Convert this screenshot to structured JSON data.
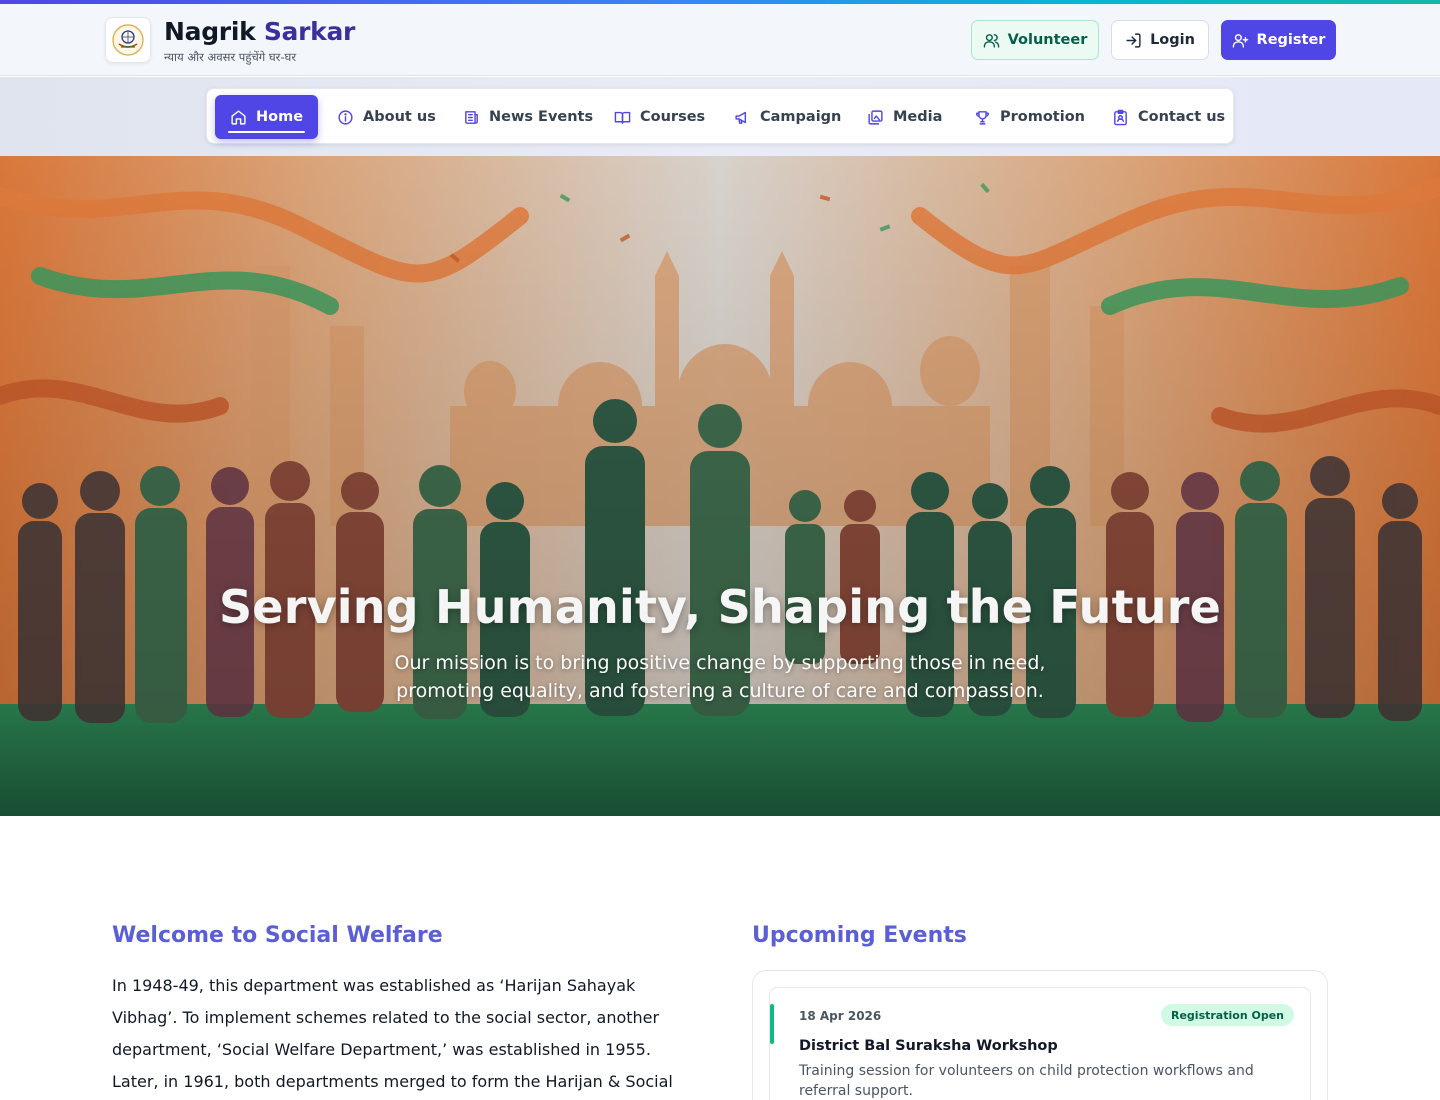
{
  "brand": {
    "name_part1": "Nagrik",
    "name_part2": "Sarkar",
    "tagline": "न्याय और अवसर पहुंचेंगे घर-घर",
    "logo_icon": "emblem-logo"
  },
  "header_actions": {
    "volunteer": "Volunteer",
    "login": "Login",
    "register": "Register"
  },
  "nav": {
    "items": [
      {
        "label": "Home",
        "icon": "home-icon",
        "active": true
      },
      {
        "label": "About us",
        "icon": "info-icon"
      },
      {
        "label": "News Events",
        "icon": "newspaper-icon"
      },
      {
        "label": "Courses",
        "icon": "book-icon"
      },
      {
        "label": "Campaign",
        "icon": "megaphone-icon"
      },
      {
        "label": "Media",
        "icon": "gallery-icon"
      },
      {
        "label": "Promotion",
        "icon": "trophy-icon"
      },
      {
        "label": "Contact us",
        "icon": "contact-badge-icon"
      }
    ]
  },
  "hero": {
    "title": "Serving Humanity, Shaping the Future",
    "subtitle": "Our mission is to bring positive change by supporting those in need, promoting equality, and fostering a culture of care and compassion."
  },
  "welcome": {
    "heading": "Welcome to Social Welfare",
    "body": "In 1948-49, this department was established as ‘Harijan Sahayak Vibhag’. To implement schemes related to the social sector, another department, ‘Social Welfare Department,’ was established in 1955. Later, in 1961, both departments merged to form the Harijan & Social Welfare Department,"
  },
  "events": {
    "heading": "Upcoming Events",
    "items": [
      {
        "date": "18 Apr 2026",
        "badge": "Registration Open",
        "title": "District Bal Suraksha Workshop",
        "description": "Training session for volunteers on child protection workflows and referral support."
      }
    ]
  },
  "colors": {
    "primary": "#4f46e5",
    "heading_accent": "#5b5fd6",
    "success": "#10b981",
    "success_bg": "#d1fae5"
  }
}
